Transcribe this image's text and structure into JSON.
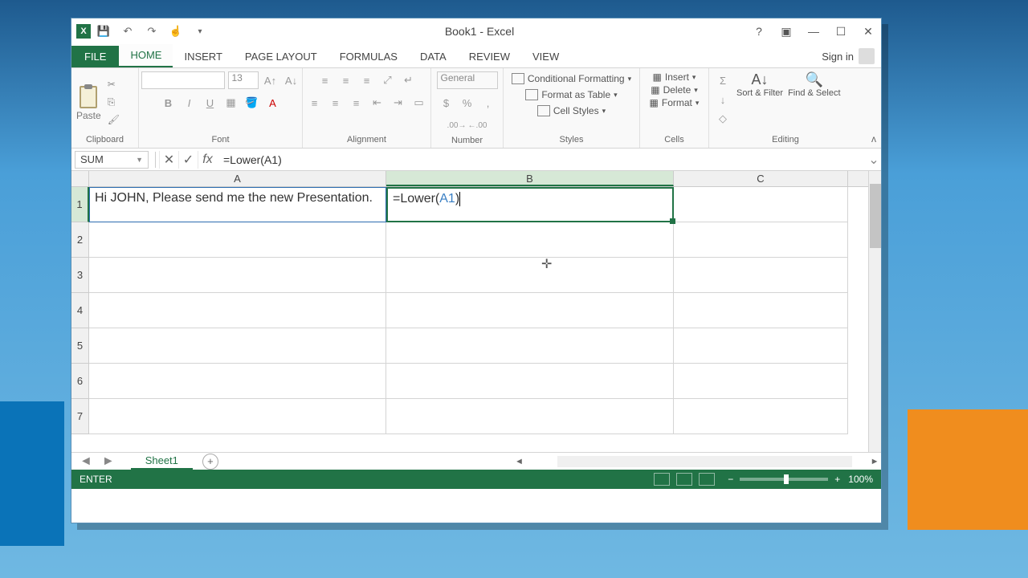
{
  "window": {
    "title": "Book1 - Excel"
  },
  "tabs": {
    "file": "FILE",
    "home": "HOME",
    "insert": "INSERT",
    "page_layout": "PAGE LAYOUT",
    "formulas": "FORMULAS",
    "data": "DATA",
    "review": "REVIEW",
    "view": "VIEW"
  },
  "signin": "Sign in",
  "ribbon": {
    "clipboard": {
      "paste": "Paste",
      "label": "Clipboard"
    },
    "font": {
      "size": "13",
      "label": "Font"
    },
    "alignment": {
      "label": "Alignment"
    },
    "number": {
      "format": "General",
      "label": "Number"
    },
    "styles": {
      "conditional": "Conditional Formatting",
      "table": "Format as Table",
      "cell": "Cell Styles",
      "label": "Styles"
    },
    "cells": {
      "insert": "Insert",
      "delete": "Delete",
      "format": "Format",
      "label": "Cells"
    },
    "editing": {
      "sort": "Sort & Filter",
      "find": "Find & Select",
      "label": "Editing"
    }
  },
  "formula_bar": {
    "name_box": "SUM",
    "formula": "=Lower(A1)"
  },
  "columns": [
    "A",
    "B",
    "C"
  ],
  "rows": [
    "1",
    "2",
    "3",
    "4",
    "5",
    "6",
    "7"
  ],
  "cells": {
    "A1": "Hi JOHN, Please send me the new Presentation.",
    "B1_prefix": "=Lower(",
    "B1_ref": "A1",
    "B1_suffix": ")"
  },
  "sheet": {
    "name": "Sheet1"
  },
  "status": {
    "mode": "ENTER",
    "zoom": "100%"
  }
}
